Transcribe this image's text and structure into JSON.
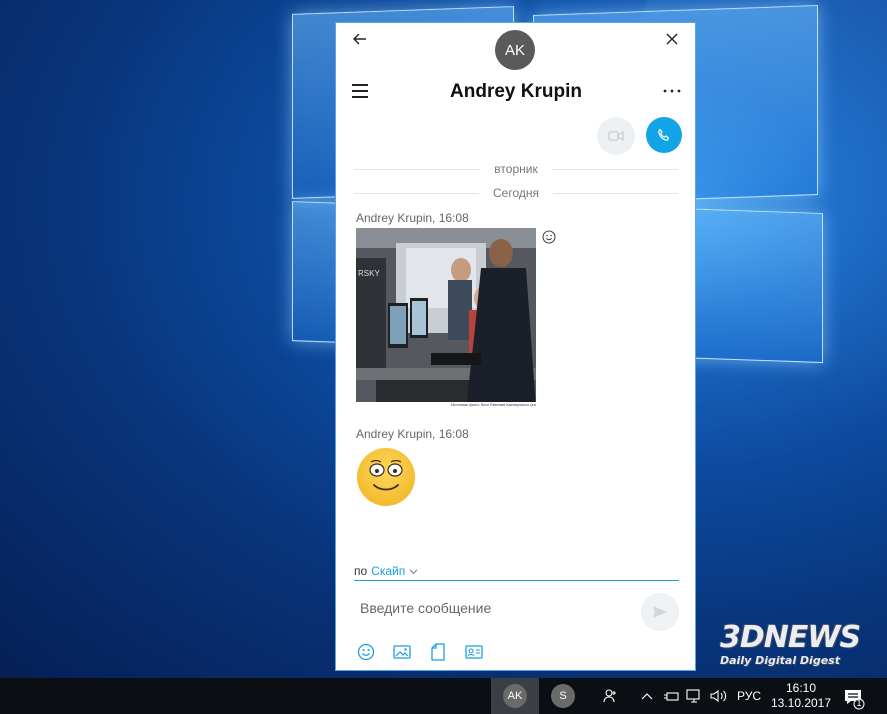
{
  "window": {
    "avatar_initials": "AK",
    "contact_name": "Andrey Krupin"
  },
  "chat": {
    "dividers": [
      "вторник",
      "Сегодня"
    ],
    "messages": [
      {
        "sender": "Andrey Krupin, 16:08",
        "type": "photo",
        "caption": "Источник фото: блог Евгения Касперского (eu"
      },
      {
        "sender": "Andrey Krupin, 16:08",
        "type": "emoji"
      }
    ]
  },
  "composer": {
    "via_prefix": "по",
    "via_service": "Скайп",
    "placeholder": "Введите сообщение"
  },
  "toolbar_icons": [
    "emoji-icon",
    "image-icon",
    "file-icon",
    "contact-card-icon"
  ],
  "taskbar": {
    "apps": [
      {
        "label": "AK",
        "active": true
      },
      {
        "label": "S",
        "active": false
      }
    ],
    "language": "РУС",
    "time": "16:10",
    "date": "13.10.2017",
    "notification_count": "1"
  },
  "watermark": {
    "logo": "3DNEWS",
    "tagline": "Daily Digital Digest"
  },
  "colors": {
    "accent": "#11a4e6",
    "window_border": "#58a4e6",
    "taskbar": "#0b0f14"
  }
}
